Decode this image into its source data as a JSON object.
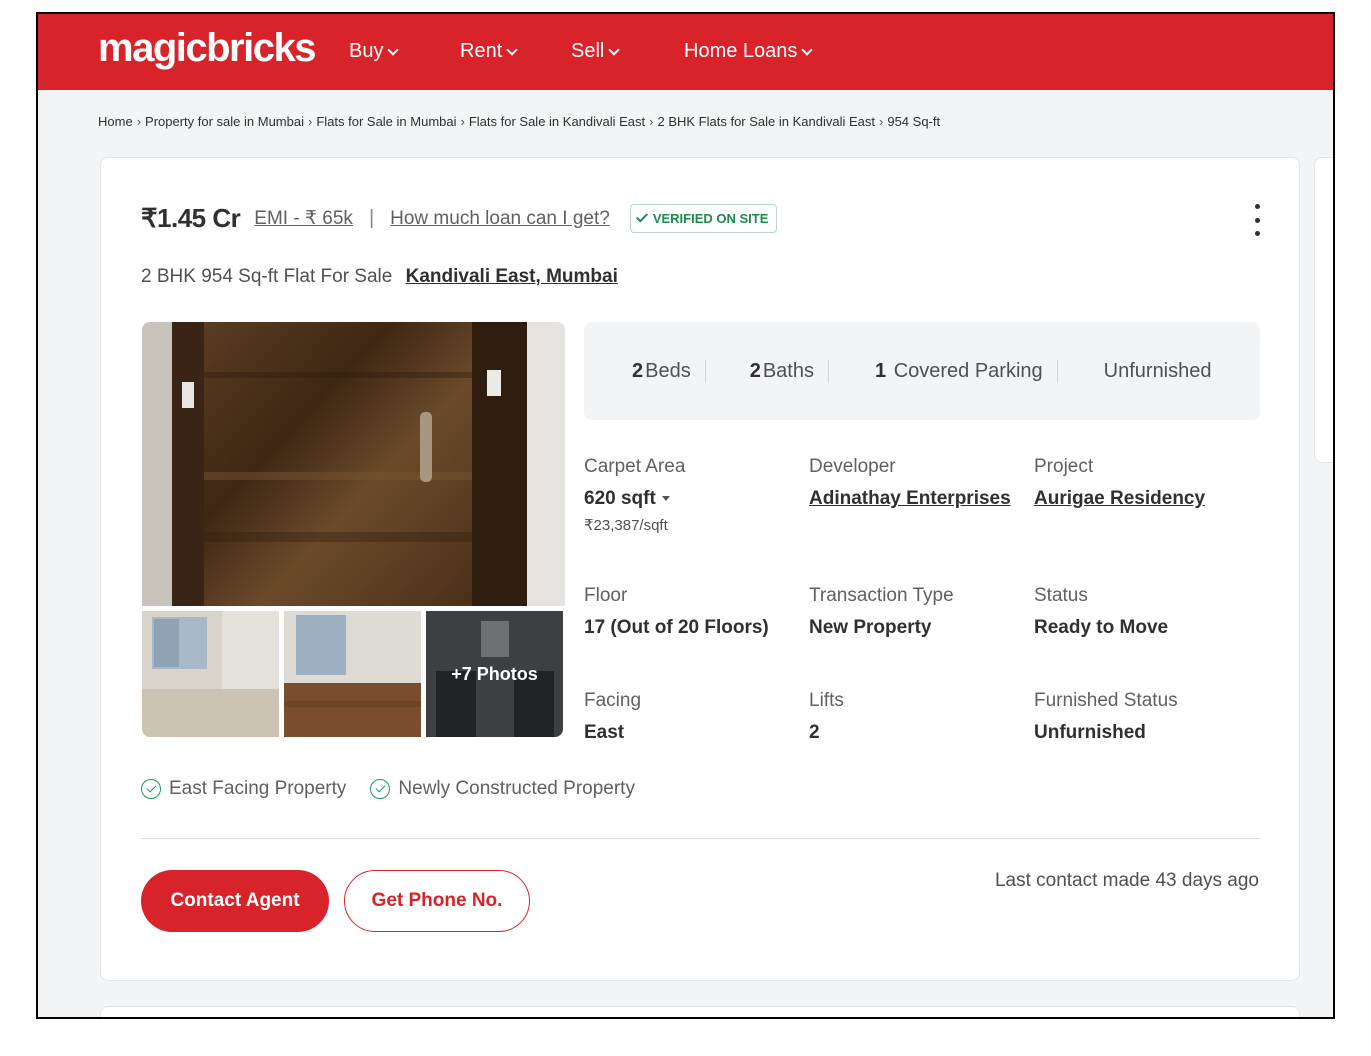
{
  "header": {
    "logo": "magicbricks",
    "nav": [
      "Buy",
      "Rent",
      "Sell",
      "Home Loans"
    ]
  },
  "breadcrumb": [
    "Home",
    "Property for sale in Mumbai",
    "Flats for Sale in Mumbai",
    "Flats for Sale in Kandivali East",
    "2 BHK Flats for Sale in Kandivali East",
    "954 Sq-ft"
  ],
  "listing": {
    "price": "₹1.45 Cr",
    "emi": "EMI - ₹ 65k",
    "loan_link": "How much loan can I get?",
    "verified": "VERIFIED ON SITE",
    "title": "2 BHK 954 Sq-ft Flat For Sale",
    "location": "Kandivali East, Mumbai",
    "more_photos": "+7 Photos",
    "summary": {
      "beds_count": "2",
      "beds_label": "Beds",
      "baths_count": "2",
      "baths_label": "Baths",
      "parking_count": "1",
      "parking_label": "Covered Parking",
      "furnishing": "Unfurnished"
    },
    "attributes": {
      "carpet_area": {
        "label": "Carpet Area",
        "value": "620 sqft",
        "sub": "₹23,387/sqft"
      },
      "developer": {
        "label": "Developer",
        "value": "Adinathay Enterprises"
      },
      "project": {
        "label": "Project",
        "value": "Aurigae Residency"
      },
      "floor": {
        "label": "Floor",
        "value": "17 (Out of 20 Floors)"
      },
      "transaction": {
        "label": "Transaction Type",
        "value": "New Property"
      },
      "status": {
        "label": "Status",
        "value": "Ready to Move"
      },
      "facing": {
        "label": "Facing",
        "value": "East"
      },
      "lifts": {
        "label": "Lifts",
        "value": "2"
      },
      "furnished": {
        "label": "Furnished Status",
        "value": "Unfurnished"
      }
    },
    "tags": [
      "East Facing Property",
      "Newly Constructed Property"
    ],
    "actions": {
      "contact": "Contact Agent",
      "phone": "Get Phone No."
    },
    "last_contact": "Last contact made 43 days ago"
  },
  "colors": {
    "brand_red": "#d8232a",
    "verified_green": "#1d8a4f"
  }
}
